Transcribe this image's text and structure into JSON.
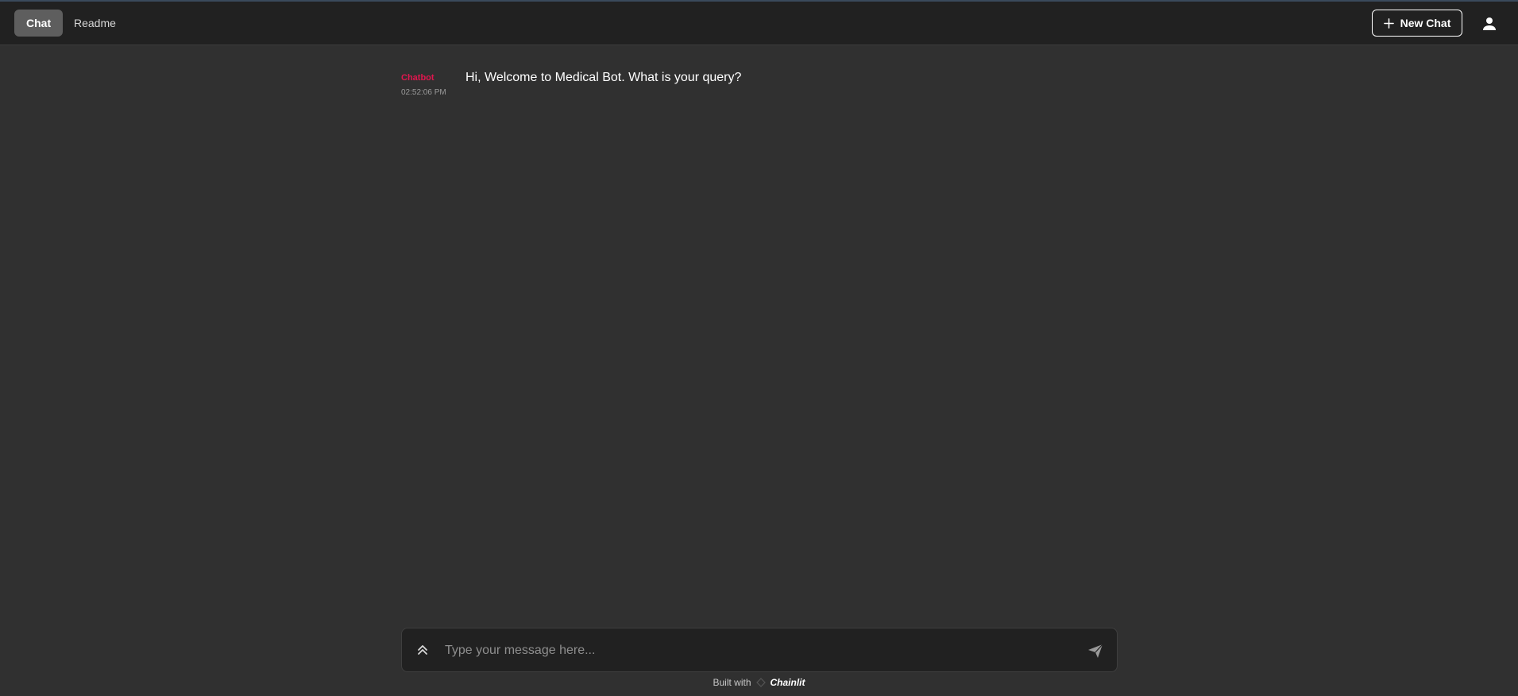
{
  "header": {
    "tabs": [
      {
        "label": "Chat",
        "active": true
      },
      {
        "label": "Readme",
        "active": false
      }
    ],
    "new_chat_label": "New Chat",
    "new_chat_icon": "plus-icon",
    "user_icon": "user-icon"
  },
  "messages": [
    {
      "author": "Chatbot",
      "time": "02:52:06 PM",
      "text": "Hi, Welcome to Medical Bot. What is your query?"
    }
  ],
  "composer": {
    "placeholder": "Type your message here...",
    "value": "",
    "expand_icon": "chevrons-up-icon",
    "send_icon": "send-icon"
  },
  "footer": {
    "built_with": "Built with",
    "brand": "Chainlit"
  },
  "colors": {
    "background": "#303030",
    "header_bg": "#212121",
    "author": "#e0164e",
    "active_tab": "#5e5e5e"
  }
}
